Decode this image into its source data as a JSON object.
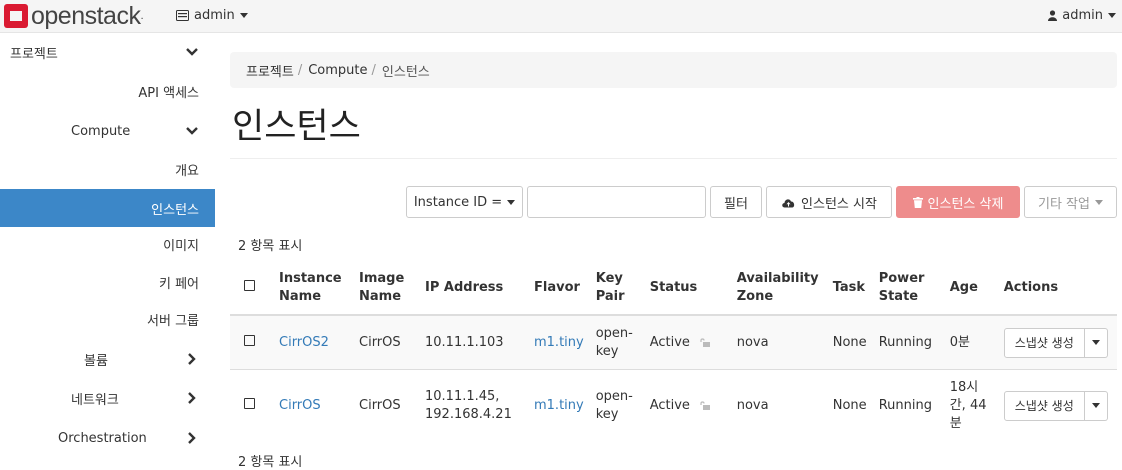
{
  "header": {
    "logo_text": "openstack",
    "project": "admin",
    "user": "admin"
  },
  "sidebar": {
    "project": "프로젝트",
    "api_access": "API 액세스",
    "compute": "Compute",
    "overview": "개요",
    "instances": "인스턴스",
    "images": "이미지",
    "key_pairs": "키 페어",
    "server_groups": "서버 그룹",
    "volumes": "볼륨",
    "network": "네트워크",
    "orchestration": "Orchestration"
  },
  "breadcrumb": {
    "items": [
      "프로젝트",
      "Compute",
      "인스턴스"
    ]
  },
  "page_title": "인스턴스",
  "toolbar": {
    "filter_field": "Instance ID =",
    "filter_value": "",
    "filter_button": "필터",
    "launch_button": "인스턴스 시작",
    "delete_button": "인스턴스 삭제",
    "more_actions": "기타 작업"
  },
  "count_text": "2 항목 표시",
  "count_text_bottom": "2 항목 표시",
  "table": {
    "headers": {
      "name": [
        "Instance",
        "Name"
      ],
      "image": [
        "Image",
        "Name"
      ],
      "ip": "IP Address",
      "flavor": "Flavor",
      "key": [
        "Key",
        "Pair"
      ],
      "status": "Status",
      "az": [
        "Availability",
        "Zone"
      ],
      "task": "Task",
      "power": [
        "Power",
        "State"
      ],
      "age": "Age",
      "actions": "Actions"
    },
    "rows": [
      {
        "name": "CirrOS2",
        "image": "CirrOS",
        "ip": [
          "10.11.1.103"
        ],
        "flavor": "m1.tiny",
        "key": [
          "open-",
          "key"
        ],
        "status": "Active",
        "az": "nova",
        "task": "None",
        "power": "Running",
        "age": [
          "0분"
        ],
        "action": "스냅샷 생성"
      },
      {
        "name": "CirrOS",
        "image": "CirrOS",
        "ip": [
          "10.11.1.45,",
          "192.168.4.21"
        ],
        "flavor": "m1.tiny",
        "key": [
          "open-",
          "key"
        ],
        "status": "Active",
        "az": "nova",
        "task": "None",
        "power": "Running",
        "age": [
          "18시",
          "간, 44",
          "분"
        ],
        "action": "스냅샷 생성"
      }
    ]
  }
}
